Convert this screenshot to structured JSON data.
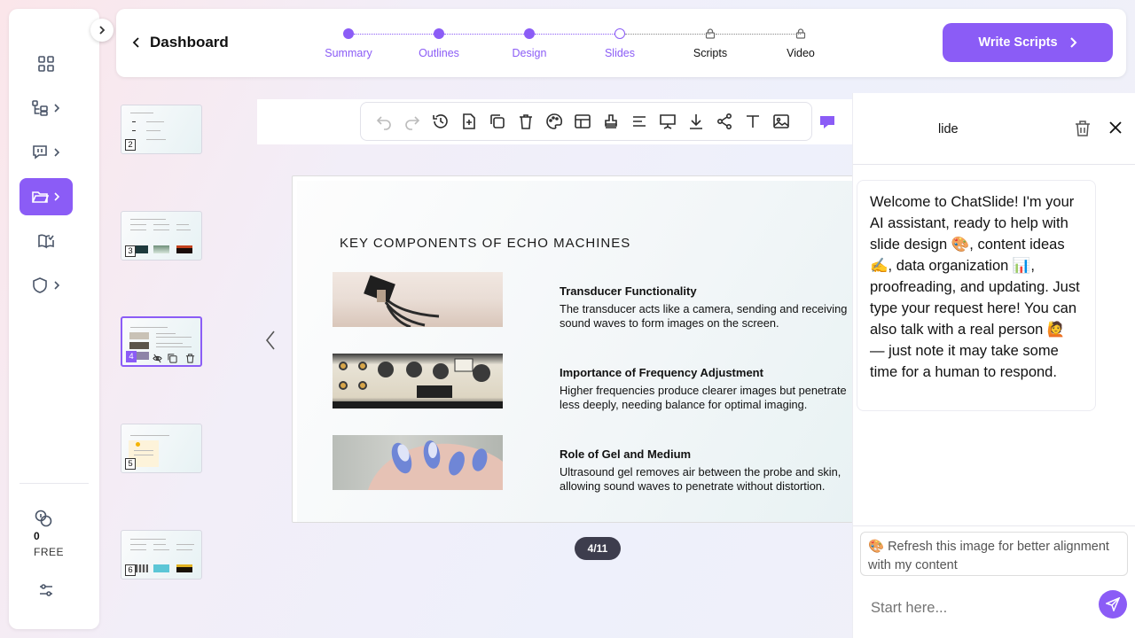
{
  "header": {
    "back_label": "Dashboard",
    "steps": [
      {
        "label": "Summary",
        "state": "done"
      },
      {
        "label": "Outlines",
        "state": "done"
      },
      {
        "label": "Design",
        "state": "done"
      },
      {
        "label": "Slides",
        "state": "current"
      },
      {
        "label": "Scripts",
        "state": "locked"
      },
      {
        "label": "Video",
        "state": "locked"
      }
    ],
    "cta_label": "Write Scripts"
  },
  "sidebar": {
    "items": [
      {
        "icon": "dashboard-grid-icon"
      },
      {
        "icon": "outline-tree-icon"
      },
      {
        "icon": "presentation-icon"
      },
      {
        "icon": "folder-icon",
        "active": true
      },
      {
        "icon": "book-check-icon"
      },
      {
        "icon": "shield-icon"
      }
    ],
    "credits": "0",
    "plan": "FREE"
  },
  "thumbnails": [
    {
      "number": "2",
      "selected": false
    },
    {
      "number": "3",
      "selected": false
    },
    {
      "number": "4",
      "selected": true
    },
    {
      "number": "5",
      "selected": false
    },
    {
      "number": "6",
      "selected": false
    }
  ],
  "slide": {
    "title": "KEY COMPONENTS OF ECHO MACHINES",
    "rows": [
      {
        "heading": "Transducer Functionality",
        "body": "The transducer acts like a camera, sending and receiving sound waves to form images on the screen."
      },
      {
        "heading": "Importance of Frequency Adjustment",
        "body": "Higher frequencies produce clearer images but penetrate less deeply, needing balance for optimal imaging."
      },
      {
        "heading": "Role of Gel and Medium",
        "body": "Ultrasound gel removes air between the probe and skin, allowing sound waves to penetrate without distortion."
      }
    ]
  },
  "pager": "4/11",
  "chat": {
    "title": "lide",
    "welcome": "Welcome to ChatSlide! I'm your AI assistant, ready to help with slide design 🎨, content ideas ✍️, data organization 📊, proofreading, and updating. Just type your request here! You can also talk with a real person 🙋 — just note it may take some time for a human to respond.",
    "suggestion": "🎨 Refresh this image for better alignment with my content",
    "input_placeholder": "Start here..."
  },
  "colors": {
    "accent": "#8b5cf6",
    "pager_bg": "#3d3d4d"
  }
}
